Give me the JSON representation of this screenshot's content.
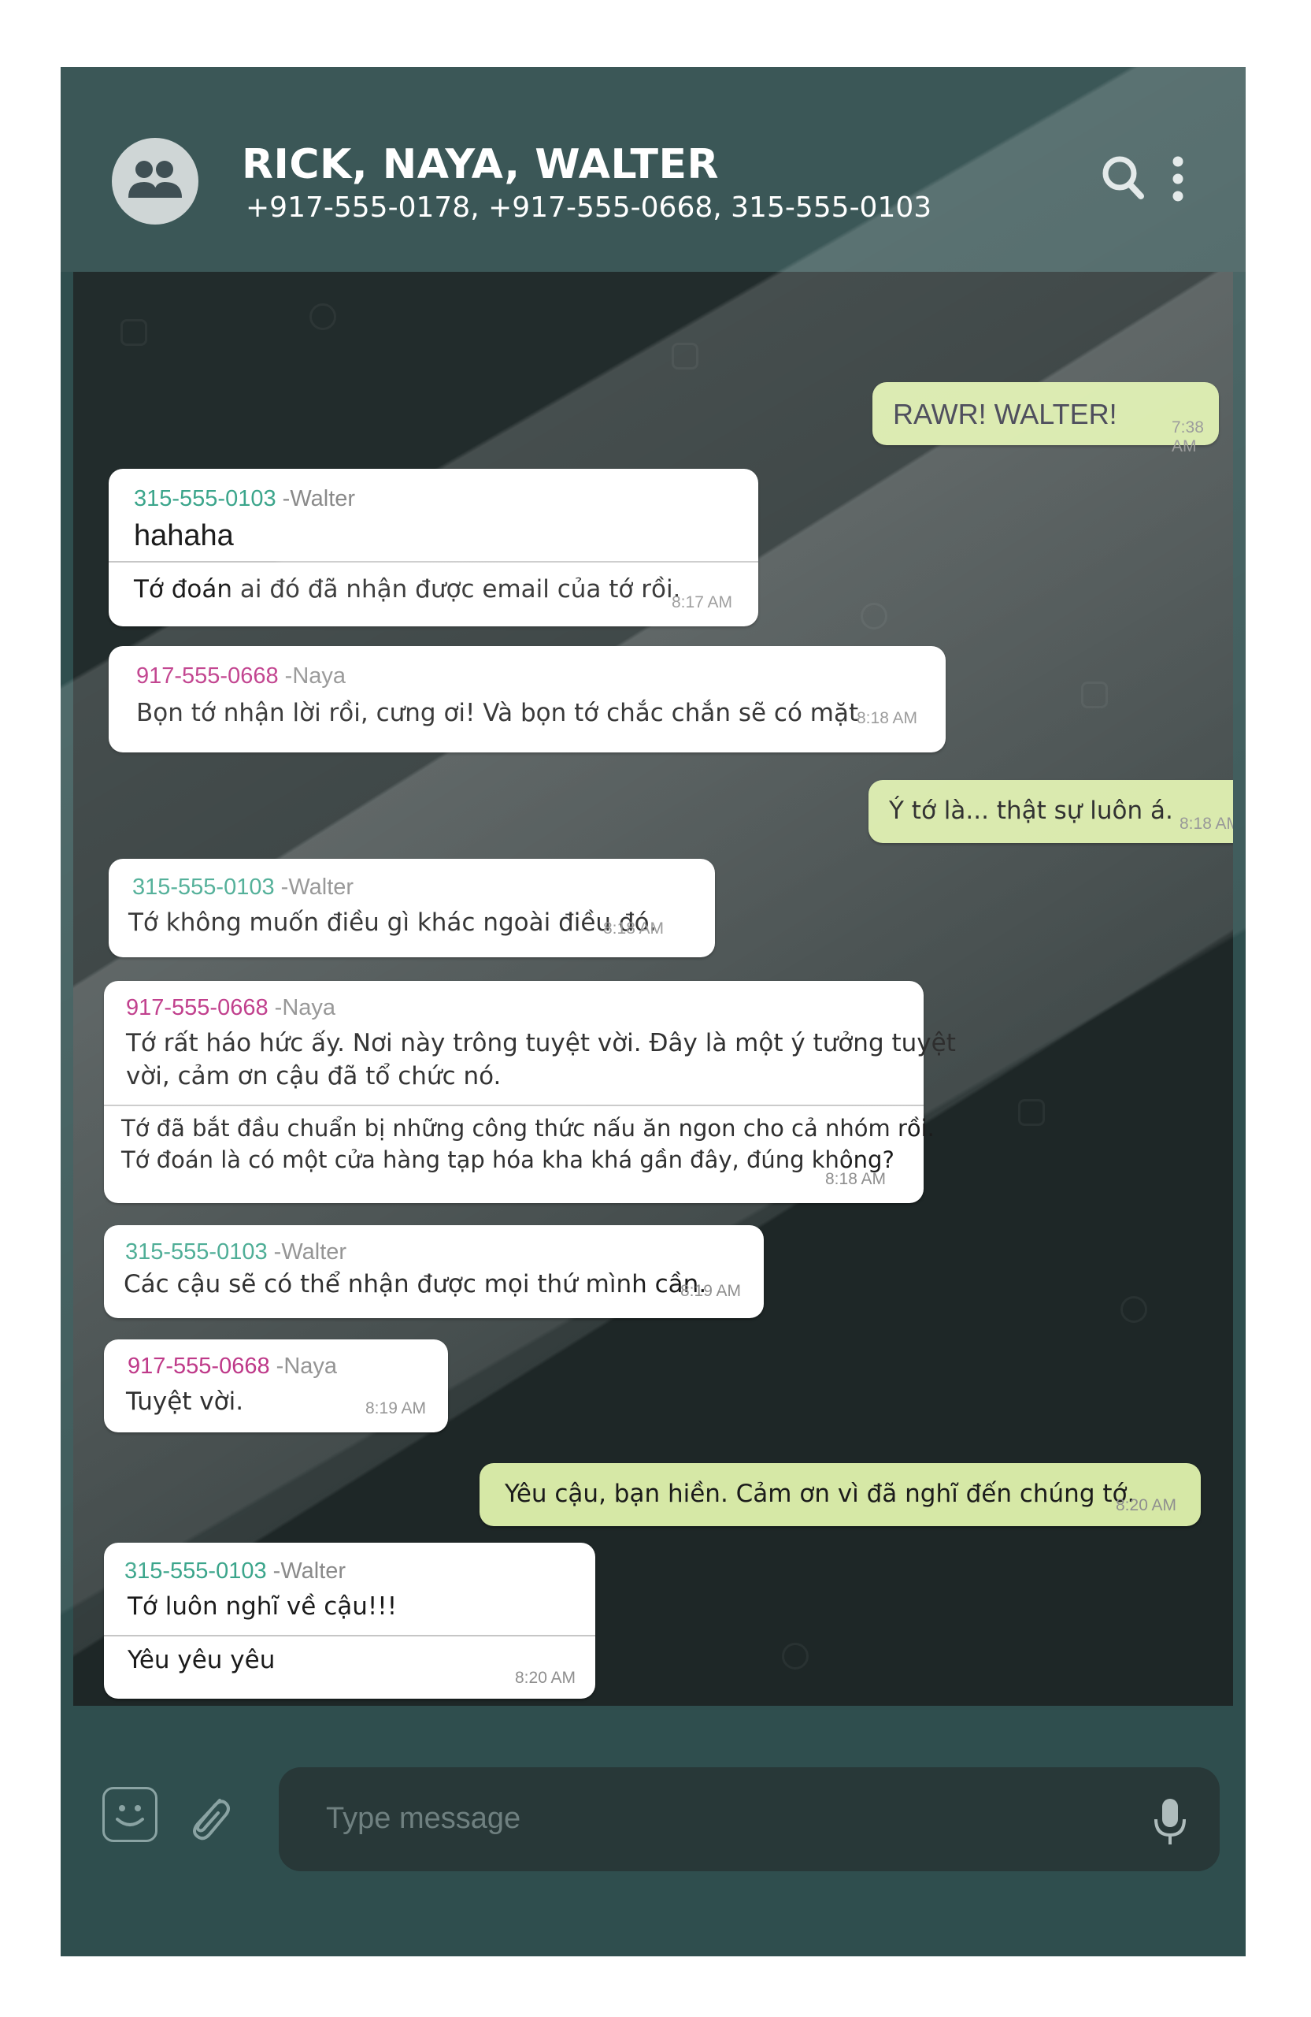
{
  "header": {
    "title": "RICK, NAYA, WALTER",
    "subtitle": "+917-555-0178, +917-555-0668, 315-555-0103",
    "avatar_icon": "group-icon",
    "search_icon": "search-icon",
    "menu_icon": "more-vert-icon"
  },
  "messages": [
    {
      "dir": "out",
      "text": "RAWR! WALTER!",
      "time": "7:38 AM"
    },
    {
      "dir": "in",
      "number": "315-555-0103",
      "name": "-Walter",
      "lines": [
        "hahaha",
        "Tớ đoán ai đó đã nhận được email của tớ rồi."
      ],
      "time": "8:17 AM"
    },
    {
      "dir": "in",
      "number": "917-555-0668",
      "name": "-Naya",
      "lines": [
        "Bọn tớ nhận lời rồi, cưng ơi! Và bọn tớ chắc chắn sẽ có mặt"
      ],
      "time": "8:18 AM"
    },
    {
      "dir": "out",
      "text": "Ý tớ là... thật sự luôn á.",
      "time": "8:18 AM"
    },
    {
      "dir": "in",
      "number": "315-555-0103",
      "name": "-Walter",
      "lines": [
        "Tớ không muốn điều gì khác ngoài điều đó."
      ],
      "time": "8:18 AM"
    },
    {
      "dir": "in",
      "number": "917-555-0668",
      "name": "-Naya",
      "lines": [
        "Tớ rất háo hức ấy. Nơi này trông tuyệt vời. Đây là một ý tưởng tuyệt",
        "vời, cảm ơn cậu đã tổ chức nó.",
        "Tớ đã bắt đầu chuẩn bị những công thức nấu ăn ngon cho cả nhóm rồi.",
        "Tớ đoán là có một cửa hàng tạp hóa kha khá gần đây, đúng không?"
      ],
      "time": "8:18 AM"
    },
    {
      "dir": "in",
      "number": "315-555-0103",
      "name": "-Walter",
      "lines": [
        "Các cậu sẽ có thể nhận được mọi thứ mình cần."
      ],
      "time": "8:19 AM"
    },
    {
      "dir": "in",
      "number": "917-555-0668",
      "name": "-Naya",
      "lines": [
        "Tuyệt vời."
      ],
      "time": "8:19 AM"
    },
    {
      "dir": "out",
      "text": "Yêu cậu, bạn hiền. Cảm ơn vì đã nghĩ đến chúng tớ.",
      "time": "8:20 AM"
    },
    {
      "dir": "in",
      "number": "315-555-0103",
      "name": "-Walter",
      "lines": [
        "Tớ luôn nghĩ về cậu!!!",
        "Yêu yêu yêu"
      ],
      "time": "8:20 AM"
    }
  ],
  "composer": {
    "placeholder": "Type message",
    "emoji_icon": "emoji-icon",
    "attach_icon": "paperclip-icon",
    "mic_icon": "microphone-icon"
  },
  "colors": {
    "frame": "#2f4e4e",
    "chat_bg": "#222c2c",
    "outgoing_bubble": "#d6e8a6",
    "incoming_bubble": "#ffffff",
    "walter_number": "#3ba58b",
    "naya_number": "#b8257d"
  }
}
